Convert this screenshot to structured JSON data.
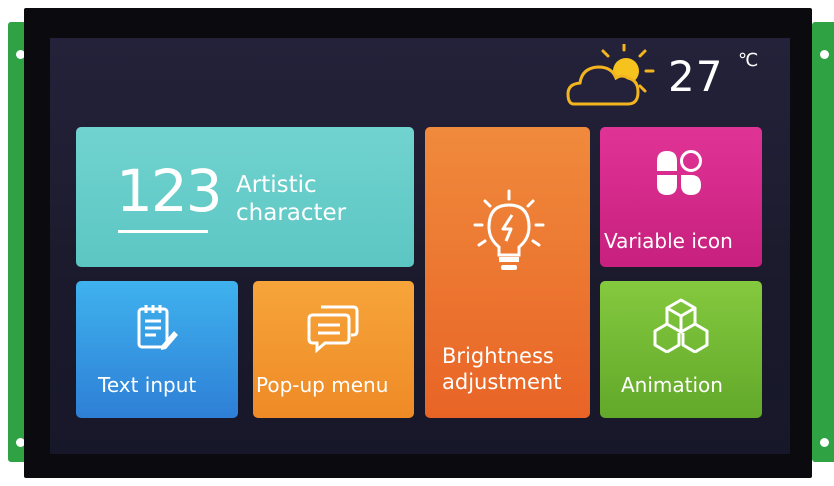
{
  "weather": {
    "temperature": "27",
    "unit": "℃",
    "icon": "cloud-sun-icon"
  },
  "tiles": {
    "artistic": {
      "number": "123",
      "label_line1": "Artistic",
      "label_line2": "character",
      "color": "#66cdc9"
    },
    "text_input": {
      "label": "Text input",
      "icon": "notepad-icon",
      "color": "#3a9de6"
    },
    "popup": {
      "label": "Pop-up menu",
      "icon": "chat-bubbles-icon",
      "color": "#f39a33"
    },
    "brightness": {
      "label_line1": "Brightness",
      "label_line2": "adjustment",
      "icon": "lightbulb-icon",
      "color": "#ec7530"
    },
    "variable": {
      "label": "Variable icon",
      "icon": "flower-icon",
      "color": "#d92a8c"
    },
    "animation": {
      "label": "Animation",
      "icon": "cubes-icon",
      "color": "#74b935"
    }
  }
}
